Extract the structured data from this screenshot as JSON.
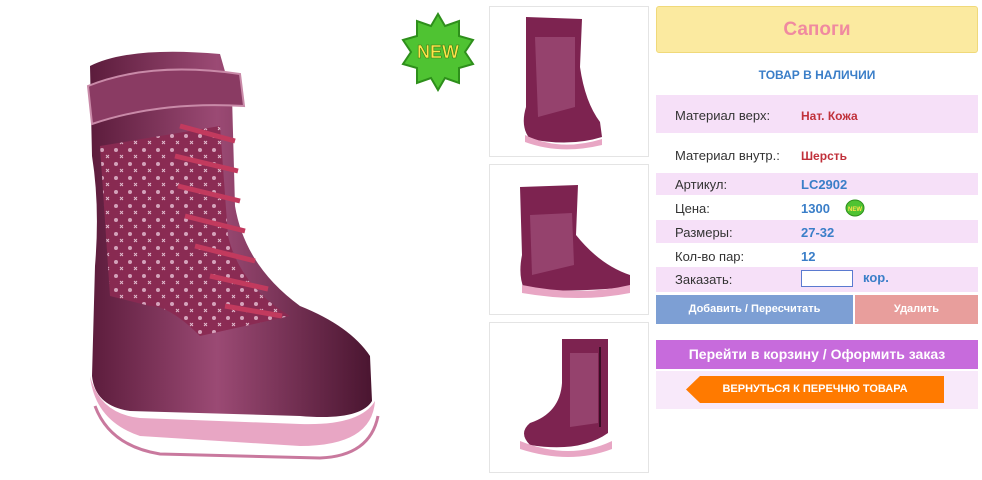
{
  "product": {
    "title": "Сапоги",
    "stock_status": "ТОВАР В НАЛИЧИИ",
    "badge": "NEW",
    "small_badge": "NEW"
  },
  "specs": {
    "material_top_label": "Материал верх:",
    "material_top_value": "Нат. Кожа",
    "material_inner_label": "Материал внутр.:",
    "material_inner_value": "Шерсть",
    "article_label": "Артикул:",
    "article_value": "LC2902",
    "price_label": "Цена:",
    "price_value": "1300",
    "sizes_label": "Размеры:",
    "sizes_value": "27-32",
    "pairs_label": "Кол-во пар:",
    "pairs_value": "12",
    "order_label": "Заказать:",
    "order_value": "",
    "order_unit": "кор."
  },
  "buttons": {
    "add": "Добавить / Пересчитать",
    "delete": "Удалить",
    "cart": "Перейти в корзину / Оформить заказ",
    "back": "ВЕРНУТЬСЯ К ПЕРЕЧНЮ ТОВАРА"
  },
  "colors": {
    "boot": "#7d2350",
    "sole": "#e8a6c4",
    "accent_blue": "#3a7ec8",
    "back_orange": "#ff7a00"
  }
}
